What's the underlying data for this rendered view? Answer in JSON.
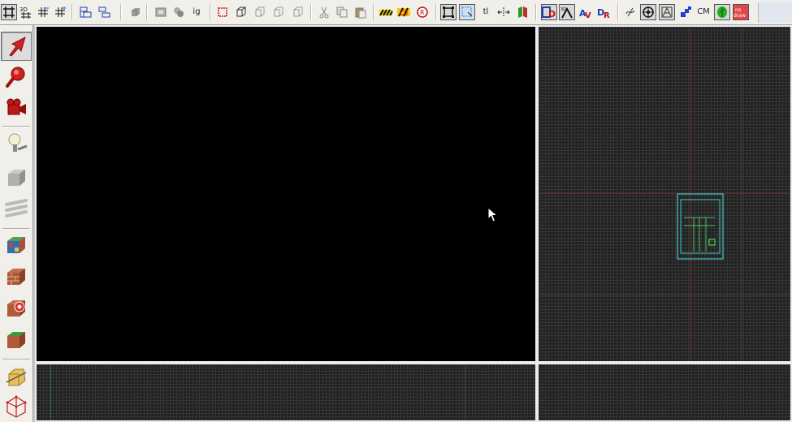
{
  "toolbar": {
    "buttons": [
      {
        "name": "grid-toggle-icon",
        "label": ""
      },
      {
        "name": "grid-3d-icon",
        "label": ""
      },
      {
        "name": "grid-smaller-icon",
        "label": ""
      },
      {
        "name": "grid-larger-icon",
        "label": ""
      },
      {
        "name": "group-icon",
        "label": ""
      },
      {
        "name": "ungroup-icon",
        "label": ""
      },
      {
        "name": "hide-selected-icon",
        "label": ""
      },
      {
        "name": "carve-icon",
        "label": ""
      },
      {
        "name": "hollow-icon",
        "label": ""
      },
      {
        "name": "ignore-groups-text",
        "label": "ig"
      },
      {
        "name": "clip-icon",
        "label": ""
      },
      {
        "name": "vertex-icon",
        "label": ""
      },
      {
        "name": "rotate-icon",
        "label": ""
      },
      {
        "name": "scale-icon",
        "label": ""
      },
      {
        "name": "skew-icon",
        "label": ""
      },
      {
        "name": "cut-icon",
        "label": ""
      },
      {
        "name": "copy-icon",
        "label": ""
      },
      {
        "name": "paste-icon",
        "label": ""
      },
      {
        "name": "texture-lock-icon",
        "label": ""
      },
      {
        "name": "texture-scale-lock-icon",
        "label": ""
      },
      {
        "name": "reset-icon",
        "label": "R"
      },
      {
        "name": "selection-box-icon",
        "label": ""
      },
      {
        "name": "select-by-handles-icon",
        "label": ""
      },
      {
        "name": "toggle-text-label",
        "label": "tl"
      },
      {
        "name": "flip-horizontal-icon",
        "label": ""
      },
      {
        "name": "flip-vertical-icon",
        "label": ""
      },
      {
        "name": "view-front-icon",
        "label": ""
      },
      {
        "name": "view-3d-icon",
        "label": "3D"
      },
      {
        "name": "view-top-icon",
        "label": ""
      },
      {
        "name": "view-side-icon",
        "label": ""
      },
      {
        "name": "snap-icon",
        "label": ""
      },
      {
        "name": "target-icon",
        "label": ""
      },
      {
        "name": "wireframe-icon",
        "label": ""
      },
      {
        "name": "blue-squares-icon",
        "label": ""
      },
      {
        "name": "cm-text-label",
        "label": "CM"
      },
      {
        "name": "leaf-icon",
        "label": ""
      },
      {
        "name": "no-draw-icon",
        "label": "no draw"
      }
    ]
  },
  "sidebar": {
    "tools": [
      {
        "name": "selection-tool-icon"
      },
      {
        "name": "magnify-tool-icon"
      },
      {
        "name": "camera-tool-icon"
      },
      {
        "name": "entity-tool-icon"
      },
      {
        "name": "block-tool-icon"
      },
      {
        "name": "overlay-tool-icon"
      },
      {
        "name": "texture-application-icon"
      },
      {
        "name": "apply-current-texture-icon"
      },
      {
        "name": "apply-decals-icon"
      },
      {
        "name": "apply-overlays-icon"
      },
      {
        "name": "clipping-tool-icon"
      },
      {
        "name": "vertex-tool-icon"
      }
    ]
  },
  "viewports": {
    "names": [
      "camera-3d-viewport",
      "top-2d-viewport",
      "front-2d-viewport",
      "side-2d-viewport"
    ]
  },
  "colors": {
    "viewport_3d_bg": "#000000",
    "grid_bg": "#202020",
    "grid_line": "#363636",
    "brush_outline": "#3fc8c0",
    "brush_highlight": "#44d944"
  }
}
